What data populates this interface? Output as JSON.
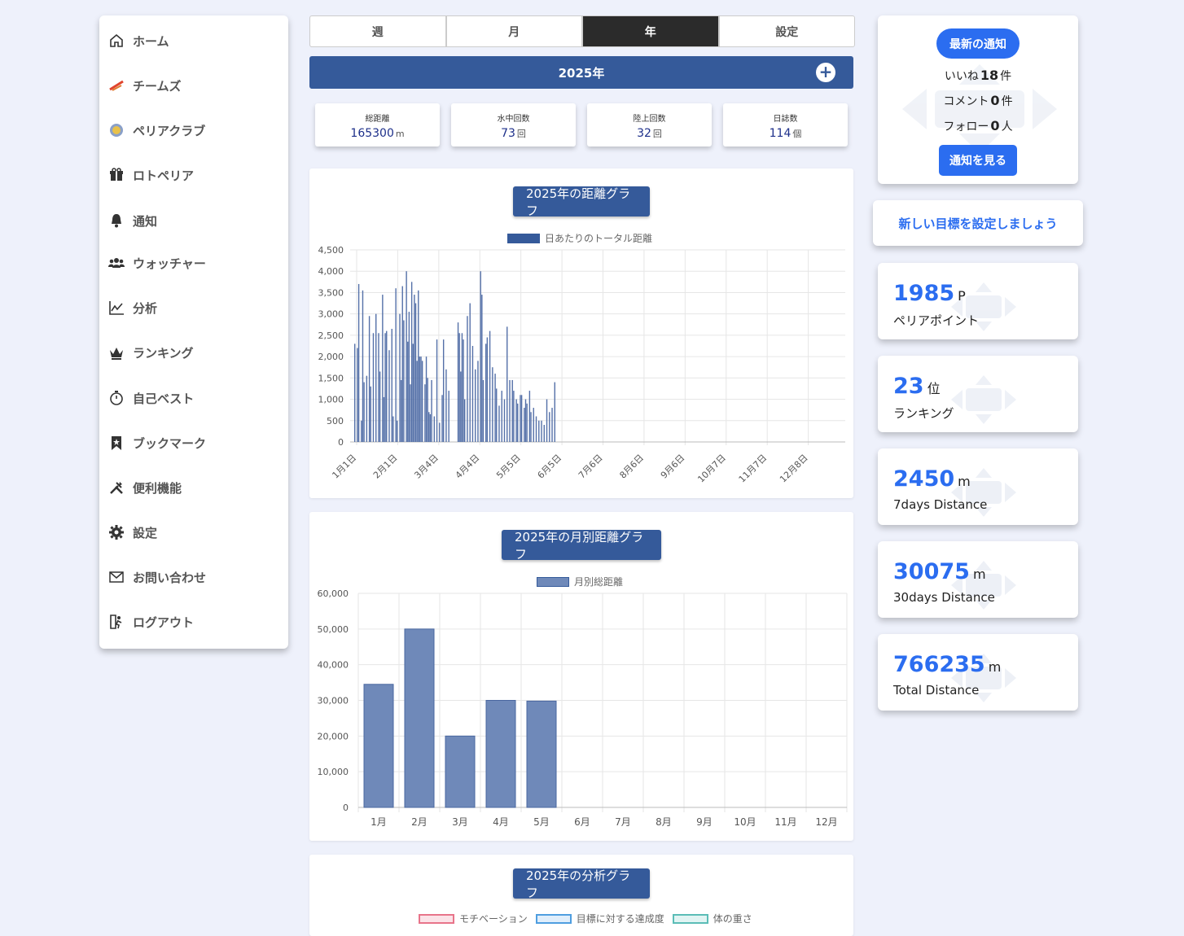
{
  "sidebar": {
    "items": [
      {
        "label": "ホーム",
        "icon": "home-icon"
      },
      {
        "label": "チームズ",
        "icon": "teams-logo-icon"
      },
      {
        "label": "ペリアクラブ",
        "icon": "club-badge-icon"
      },
      {
        "label": "ロトペリア",
        "icon": "gift-icon"
      },
      {
        "label": "通知",
        "icon": "bell-icon"
      },
      {
        "label": "ウォッチャー",
        "icon": "users-icon"
      },
      {
        "label": "分析",
        "icon": "line-chart-icon"
      },
      {
        "label": "ランキング",
        "icon": "crown-icon"
      },
      {
        "label": "自己ベスト",
        "icon": "stopwatch-icon"
      },
      {
        "label": "ブックマーク",
        "icon": "bookmark-icon"
      },
      {
        "label": "便利機能",
        "icon": "tools-icon"
      },
      {
        "label": "設定",
        "icon": "gear-icon"
      },
      {
        "label": "お問い合わせ",
        "icon": "mail-icon"
      },
      {
        "label": "ログアウト",
        "icon": "logout-icon"
      }
    ]
  },
  "tabs": [
    "週",
    "月",
    "年",
    "設定"
  ],
  "active_tab": "年",
  "year_bar": {
    "title": "2025年",
    "add": "+"
  },
  "stats": [
    {
      "label": "総距離",
      "value": "165300",
      "unit": "m"
    },
    {
      "label": "水中回数",
      "value": "73",
      "unit": "回"
    },
    {
      "label": "陸上回数",
      "value": "32",
      "unit": "回"
    },
    {
      "label": "日誌数",
      "value": "114",
      "unit": "個"
    }
  ],
  "colors": {
    "accent": "#2b6df0",
    "navy": "#355a9a",
    "bar_fill": "#6f89b9"
  },
  "chart_data": [
    {
      "type": "bar",
      "title": "2025年の距離グラフ",
      "legend": "日あたりのトータル距離",
      "ylim": [
        0,
        4500
      ],
      "y_ticks": [
        "0",
        "500",
        "1,000",
        "1,500",
        "2,000",
        "2,500",
        "3,000",
        "3,500",
        "4,000",
        "4,500"
      ],
      "x_ticks": [
        "1月1日",
        "2月1日",
        "3月4日",
        "4月4日",
        "5月5日",
        "6月5日",
        "7月6日",
        "8月6日",
        "9月6日",
        "10月7日",
        "11月7日",
        "12月8日"
      ],
      "x_start": "2025-01-01",
      "x_end": "2025-12-31",
      "series": [
        {
          "x": [
            "2025-01-01",
            "2025-01-03",
            "2025-01-04",
            "2025-01-06",
            "2025-01-07",
            "2025-01-08",
            "2025-01-10",
            "2025-01-12",
            "2025-01-13",
            "2025-01-15",
            "2025-01-17",
            "2025-01-19",
            "2025-01-20",
            "2025-01-22",
            "2025-01-23",
            "2025-01-24",
            "2025-01-25",
            "2025-01-27",
            "2025-01-29",
            "2025-01-30",
            "2025-02-01",
            "2025-02-02",
            "2025-02-04",
            "2025-02-05",
            "2025-02-06",
            "2025-02-07",
            "2025-02-09",
            "2025-02-10",
            "2025-02-11",
            "2025-02-12",
            "2025-02-13",
            "2025-02-14",
            "2025-02-15",
            "2025-02-16",
            "2025-02-17",
            "2025-02-18",
            "2025-02-19",
            "2025-02-20",
            "2025-02-21",
            "2025-02-23",
            "2025-02-24",
            "2025-02-25",
            "2025-02-26",
            "2025-02-27",
            "2025-02-28",
            "2025-03-02",
            "2025-03-04",
            "2025-03-06",
            "2025-03-08",
            "2025-03-09",
            "2025-03-11",
            "2025-03-13",
            "2025-03-20",
            "2025-03-21",
            "2025-03-22",
            "2025-03-23",
            "2025-03-24",
            "2025-03-25",
            "2025-03-27",
            "2025-03-29",
            "2025-03-31",
            "2025-04-02",
            "2025-04-04",
            "2025-04-06",
            "2025-04-07",
            "2025-04-08",
            "2025-04-10",
            "2025-04-11",
            "2025-04-13",
            "2025-04-15",
            "2025-04-17",
            "2025-04-18",
            "2025-04-20",
            "2025-04-22",
            "2025-04-24",
            "2025-04-26",
            "2025-04-28",
            "2025-04-30",
            "2025-05-01",
            "2025-05-03",
            "2025-05-04",
            "2025-05-06",
            "2025-05-07",
            "2025-05-09",
            "2025-05-10",
            "2025-05-11",
            "2025-05-13",
            "2025-05-14",
            "2025-05-16",
            "2025-05-18",
            "2025-05-20",
            "2025-05-22",
            "2025-05-24",
            "2025-05-26",
            "2025-05-28",
            "2025-05-30",
            "2025-06-01"
          ],
          "values": [
            2300,
            2200,
            3700,
            500,
            3550,
            1400,
            1550,
            2950,
            1300,
            2550,
            3000,
            2550,
            1650,
            3450,
            1050,
            2550,
            2600,
            2150,
            2650,
            600,
            3600,
            500,
            3000,
            1450,
            3650,
            2850,
            4000,
            2350,
            3050,
            1350,
            3750,
            2300,
            3450,
            3250,
            1900,
            3550,
            2000,
            2000,
            1900,
            1350,
            2000,
            1500,
            700,
            650,
            1450,
            600,
            2400,
            450,
            1100,
            2400,
            1700,
            1200,
            2800,
            2550,
            1650,
            2550,
            2400,
            1000,
            2950,
            3250,
            2250,
            1700,
            1900,
            4000,
            3450,
            1450,
            2300,
            2450,
            2600,
            1750,
            1600,
            1250,
            850,
            1200,
            1000,
            2700,
            1450,
            1450,
            1200,
            1000,
            900,
            1100,
            1100,
            800,
            1000,
            900,
            1200,
            700,
            800,
            600,
            500,
            500,
            400,
            1000,
            700,
            800,
            1400
          ]
        }
      ]
    },
    {
      "type": "bar",
      "title": "2025年の月別距離グラフ",
      "legend": "月別総距離",
      "ylim": [
        0,
        60000
      ],
      "y_ticks": [
        "0",
        "10,000",
        "20,000",
        "30,000",
        "40,000",
        "50,000",
        "60,000"
      ],
      "categories": [
        "1月",
        "2月",
        "3月",
        "4月",
        "5月",
        "6月",
        "7月",
        "8月",
        "9月",
        "10月",
        "11月",
        "12月"
      ],
      "values": [
        34500,
        50000,
        20000,
        30000,
        29800,
        0,
        0,
        0,
        0,
        0,
        0,
        0
      ]
    }
  ],
  "analysis": {
    "title": "2025年の分析グラフ",
    "legend": [
      {
        "label": "モチベーション",
        "color": "#e8748a"
      },
      {
        "label": "目標に対する達成度",
        "color": "#4f9ee0"
      },
      {
        "label": "体の重さ",
        "color": "#5bbdb7"
      }
    ]
  },
  "notifications": {
    "button": "最新の通知",
    "likes_prefix": "いいね",
    "likes": "18",
    "likes_unit": "件",
    "comments_prefix": "コメント",
    "comments": "0",
    "comments_unit": "件",
    "follows_prefix": "フォロー",
    "follows": "0",
    "follows_unit": "人",
    "view_button": "通知を見る"
  },
  "goal_banner": "新しい目標を設定しましょう",
  "metrics": [
    {
      "value": "1985",
      "unit": "P",
      "label": "ペリアポイント"
    },
    {
      "value": "23",
      "unit": "位",
      "label": "ランキング"
    },
    {
      "value": "2450",
      "unit": "m",
      "label": "7days Distance"
    },
    {
      "value": "30075",
      "unit": "m",
      "label": "30days Distance"
    },
    {
      "value": "766235",
      "unit": "m",
      "label": "Total Distance"
    }
  ]
}
